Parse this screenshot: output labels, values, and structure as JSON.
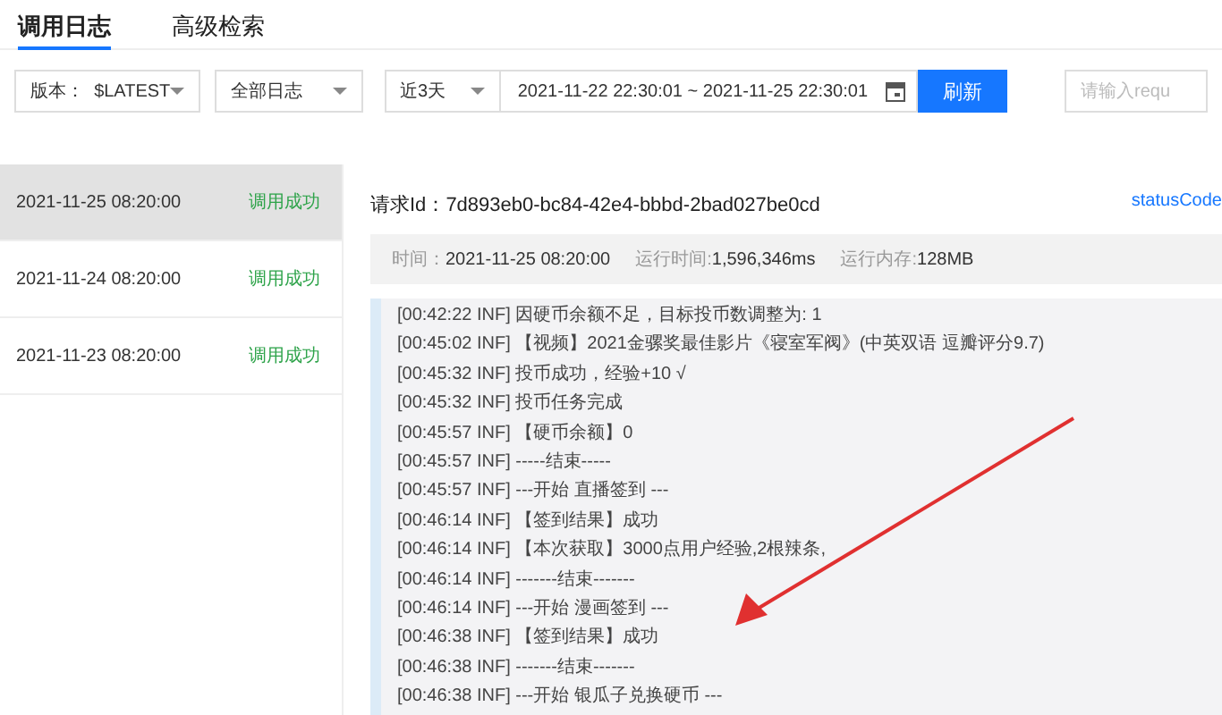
{
  "tabs": [
    {
      "label": "调用日志",
      "selected": true
    },
    {
      "label": "高级检索",
      "selected": false
    }
  ],
  "filters": {
    "version": {
      "label": "版本：",
      "value": "$LATEST"
    },
    "log_type": {
      "value": "全部日志"
    },
    "range": {
      "value": "近3天"
    },
    "date_range": {
      "value": "2021-11-22 22:30:01 ~ 2021-11-25 22:30:01"
    },
    "refresh_button": "刷新",
    "search": {
      "placeholder": "请输入requ"
    }
  },
  "invocations": [
    {
      "time": "2021-11-25 08:20:00",
      "status": "调用成功",
      "selected": true
    },
    {
      "time": "2021-11-24 08:20:00",
      "status": "调用成功",
      "selected": false
    },
    {
      "time": "2021-11-23 08:20:00",
      "status": "调用成功",
      "selected": false
    }
  ],
  "detail": {
    "request_label": "请求Id：",
    "request_id": "7d893eb0-bc84-42e4-bbbd-2bad027be0cd",
    "status_link": "statusCode",
    "meta": [
      {
        "label": "时间：",
        "value": "2021-11-25 08:20:00"
      },
      {
        "label": "运行时间:",
        "value": "1,596,346ms"
      },
      {
        "label": "运行内存:",
        "value": "128MB"
      }
    ],
    "log_lines": [
      "[00:42:22 INF] 因硬币余额不足，目标投币数调整为: 1",
      "[00:45:02 INF] 【视频】2021金骡奖最佳影片《寝室军阀》(中英双语 逗瓣评分9.7)",
      "[00:45:32 INF] 投币成功，经验+10 √",
      "[00:45:32 INF] 投币任务完成",
      "[00:45:57 INF] 【硬币余额】0",
      "[00:45:57 INF] -----结束-----",
      "[00:45:57 INF] ---开始 直播签到 ---",
      "[00:46:14 INF] 【签到结果】成功",
      "[00:46:14 INF] 【本次获取】3000点用户经验,2根辣条,",
      "[00:46:14 INF] -------结束-------",
      "[00:46:14 INF] ---开始 漫画签到 ---",
      "[00:46:38 INF] 【签到结果】成功",
      "[00:46:38 INF] -------结束-------",
      "[00:46:38 INF] ---开始 银瓜子兑换硬币 ---"
    ]
  }
}
